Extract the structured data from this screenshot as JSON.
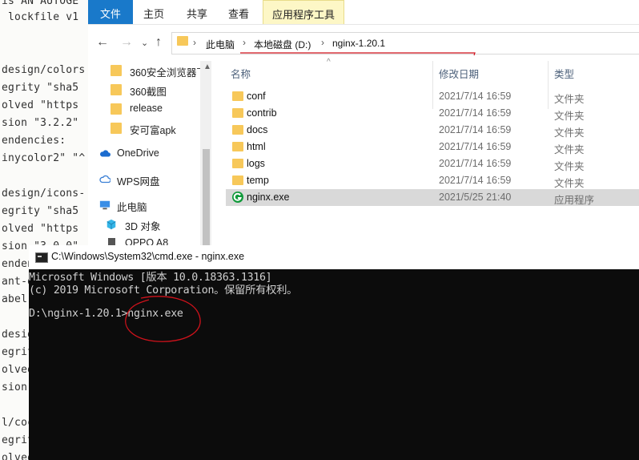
{
  "code_editor": {
    "lines": [
      "is AN AUTOGE",
      " lockfile v1",
      "",
      "",
      "design/colors",
      "egrity \"sha5",
      "olved \"https",
      "sion \"3.2.2\"",
      "endencies:",
      "inycolor2\" \"^",
      "",
      "design/icons-",
      "egrity \"sha5",
      "olved \"https",
      "sion \"3.0.0\"",
      "endenc",
      "ant-d",
      "abel-",
      "",
      "desig",
      "egrit",
      "olved",
      "sion\"",
      "",
      "l/coc",
      "egrit",
      "olved"
    ]
  },
  "explorer": {
    "ribbon_tabs": [
      "文件",
      "主页",
      "共享",
      "查看",
      "应用程序工具"
    ],
    "breadcrumb": [
      "此电脑",
      "本地磁盘 (D:)",
      "nginx-1.20.1"
    ],
    "nav_items": [
      {
        "label": "360安全浏览器下",
        "icon": "folder-icon"
      },
      {
        "label": "360截图",
        "icon": "folder-icon"
      },
      {
        "label": "release",
        "icon": "folder-icon"
      },
      {
        "label": "安可富apk",
        "icon": "folder-icon"
      },
      {
        "label": "OneDrive",
        "icon": "cloud-icon"
      },
      {
        "label": "WPS网盘",
        "icon": "cloud-icon"
      },
      {
        "label": "此电脑",
        "icon": "computer-icon"
      },
      {
        "label": "3D 对象",
        "icon": "cube-icon"
      },
      {
        "label": "OPPO A8",
        "icon": "phone-icon"
      }
    ],
    "columns": [
      "名称",
      "修改日期",
      "类型"
    ],
    "files": [
      {
        "name": "conf",
        "date": "2021/7/14 16:59",
        "type": "文件夹",
        "icon": "folder-icon"
      },
      {
        "name": "contrib",
        "date": "2021/7/14 16:59",
        "type": "文件夹",
        "icon": "folder-icon"
      },
      {
        "name": "docs",
        "date": "2021/7/14 16:59",
        "type": "文件夹",
        "icon": "folder-icon"
      },
      {
        "name": "html",
        "date": "2021/7/14 16:59",
        "type": "文件夹",
        "icon": "folder-icon"
      },
      {
        "name": "logs",
        "date": "2021/7/14 16:59",
        "type": "文件夹",
        "icon": "folder-icon"
      },
      {
        "name": "temp",
        "date": "2021/7/14 16:59",
        "type": "文件夹",
        "icon": "folder-icon"
      },
      {
        "name": "nginx.exe",
        "date": "2021/5/25 21:40",
        "type": "应用程序",
        "icon": "nginx-icon",
        "selected": true
      }
    ]
  },
  "cmd": {
    "title": "C:\\Windows\\System32\\cmd.exe - nginx.exe",
    "lines": [
      "Microsoft Windows [版本 10.0.18363.1316]",
      "(c) 2019 Microsoft Corporation。保留所有权利。",
      "",
      "D:\\nginx-1.20.1>nginx.exe"
    ]
  },
  "colors": {
    "file_tab": "#1979ca",
    "app_tools_tab": "#fdf7c6",
    "selected_row": "#d9d9d9",
    "annotation": "#d0121b"
  }
}
